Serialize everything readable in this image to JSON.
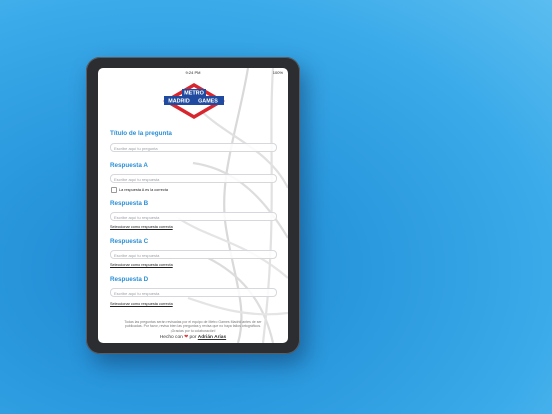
{
  "status_bar": {
    "time": "9:24 PM",
    "battery": "100%"
  },
  "logo": {
    "line1": "METRO",
    "line2": "MADRID",
    "line3": "GAMES"
  },
  "form": {
    "question_title": "Título de la pregunta",
    "question_placeholder": "Escribe aquí tu pregunta",
    "answer_a_title": "Respuesta A",
    "answer_a_placeholder": "Escribe aquí tu respuesta",
    "answer_a_correct_label": "La respuesta A es la correcta",
    "answer_b_title": "Respuesta B",
    "answer_b_placeholder": "Escribe aquí tu respuesta",
    "answer_b_select": "Seleccionar como respuesta correcta",
    "answer_c_title": "Respuesta C",
    "answer_c_placeholder": "Escribe aquí tu respuesta",
    "answer_c_select": "Seleccionar como respuesta correcta",
    "answer_d_title": "Respuesta D",
    "answer_d_placeholder": "Escribe aquí tu respuesta",
    "answer_d_select": "Seleccionar como respuesta correcta"
  },
  "footer": {
    "note_line1": "Todas las preguntas serán revisadas por el equipo de Metro Games Madrid antes de ser",
    "note_line2": "publicadas. Por favor, revisa bien las preguntas y revisa que no haya fallos ortográficos.",
    "note_line3": "¡Gracias por tu colaboración!",
    "made_with": "Hecho con",
    "by": "por",
    "author": "Adrián Arias"
  },
  "colors": {
    "accent": "#2b8fd6",
    "logo_red": "#d8262e",
    "logo_blue": "#1f4aa0"
  }
}
